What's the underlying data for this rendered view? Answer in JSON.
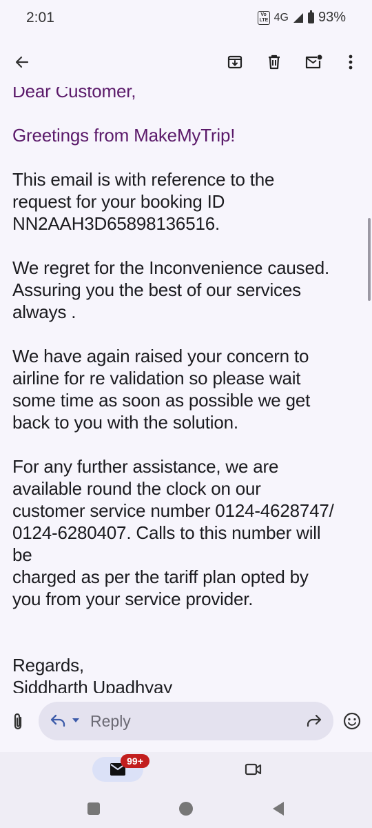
{
  "status_bar": {
    "time": "2:01",
    "volte": "Vo LTE",
    "network": "4G",
    "battery": "93%"
  },
  "toolbar": {
    "back_icon": "arrow-back-icon",
    "archive_icon": "archive-icon",
    "delete_icon": "trash-icon",
    "mark_unread_icon": "mark-unread-icon",
    "more_icon": "more-vertical-icon"
  },
  "email": {
    "lines_purple": [
      "Dear Customer,",
      "Greetings from MakeMyTrip!"
    ],
    "paragraphs": [
      [
        "This email is with reference to the",
        "request for your booking ID",
        "NN2AAH3D65898136516."
      ],
      [
        "We regret for the Inconvenience caused.",
        "Assuring you the best of our services",
        "always ."
      ],
      [
        "We have again raised your concern to",
        "airline for re validation so please wait",
        "some time as soon as possible we get",
        "back to you with the solution."
      ],
      [
        "For any further assistance, we are",
        "available round the clock on our",
        "customer service number 0124-4628747/",
        "0124-6280407. Calls to this number will",
        "be",
        "charged as per the tariff plan opted by",
        "you from your service provider."
      ]
    ],
    "signoff": [
      "Regards,",
      "Siddharth Upadhyay"
    ]
  },
  "reply_bar": {
    "attach_icon": "paperclip-icon",
    "reply_label": "Reply",
    "forward_icon": "forward-icon",
    "emoji_icon": "emoji-icon"
  },
  "bottom_nav": {
    "mail_badge": "99+",
    "mail_icon": "mail-icon",
    "meet_icon": "video-icon"
  },
  "colors": {
    "accent_purple": "#5b1a6a",
    "badge_red": "#c21e1e",
    "background": "#f7f5fc"
  }
}
